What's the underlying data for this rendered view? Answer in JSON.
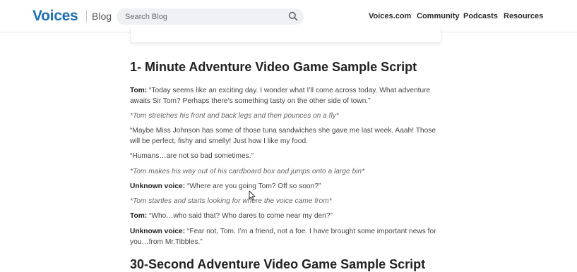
{
  "header": {
    "logo": "Voices",
    "section": "Blog",
    "search_placeholder": "Search Blog",
    "nav": [
      "Voices.com",
      "Community",
      "Podcasts",
      "Resources"
    ]
  },
  "article": {
    "heading_1": "1- Minute Adventure Video Game Sample Script",
    "lines": [
      {
        "speaker": "Tom:",
        "text": " “Today seems like an exciting day. I wonder what I’ll come across today.   What adventure awaits Sir Tom? Perhaps there’s something tasty on the other side of town.”"
      },
      {
        "speaker": "",
        "text": "*Tom stretches his front and back legs and then pounces on a fly*"
      },
      {
        "speaker": "",
        "text": "“Maybe Miss Johnson has some of those tuna sandwiches she gave me last week. Aaah! Those will be perfect, fishy and smelly! Just how I like my food."
      },
      {
        "speaker": "",
        "text": "“Humans…are not so bad sometimes.”"
      },
      {
        "speaker": "",
        "text": "*Tom makes his way out of his cardboard box and jumps onto a large bin*"
      },
      {
        "speaker": "Unknown voice:",
        "text": " “Where are you going Tom? Off so soon?”"
      },
      {
        "speaker": "",
        "text": "*Tom startles and starts looking for where the voice came from*"
      },
      {
        "speaker": "Tom:",
        "text": " “Who…who said that? Who dares to come near my den?”"
      },
      {
        "speaker": "Unknown voice:",
        "text": " “Fear not, Tom. I’m a friend, not a foe. I have brought some important news for you…from Mr.Tibbles.”"
      }
    ],
    "heading_2": "30-Second Adventure Video Game Sample Script"
  }
}
